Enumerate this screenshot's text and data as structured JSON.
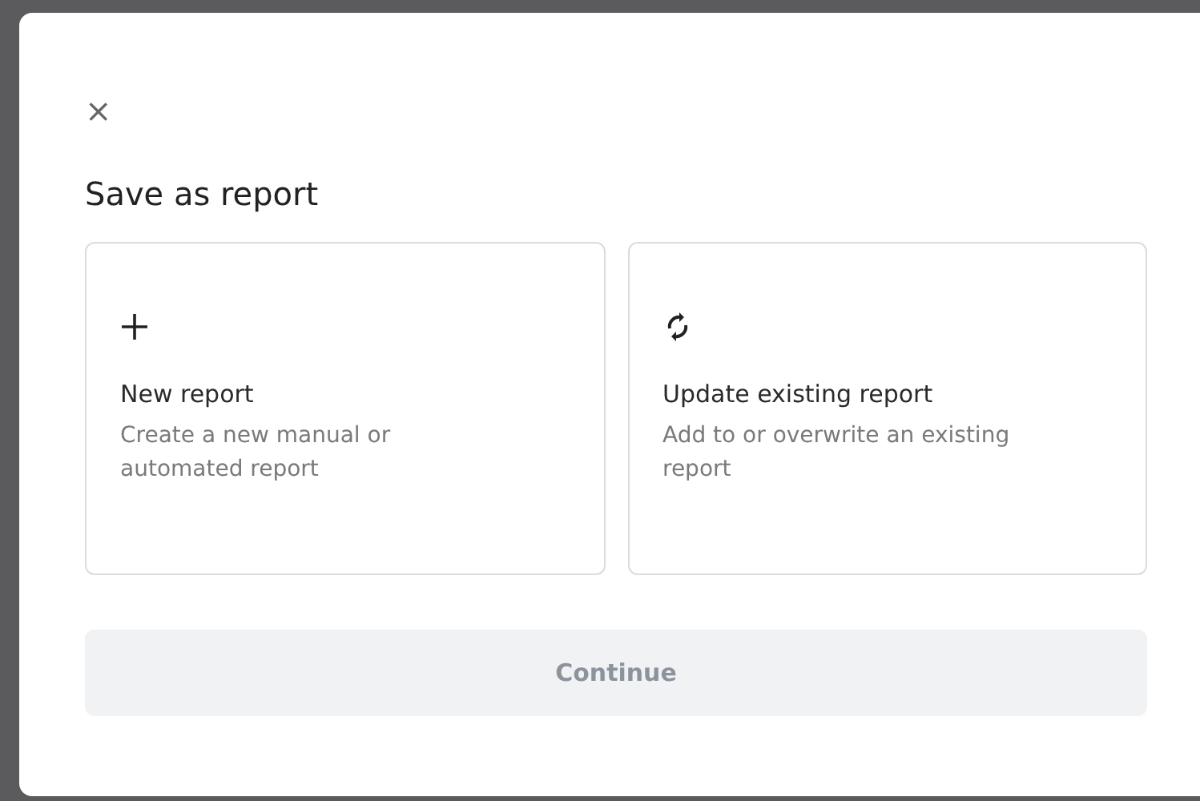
{
  "dialog": {
    "close_label": "×",
    "title": "Save as report",
    "options": [
      {
        "kind": "new",
        "title": "New report",
        "description": "Create a new manual or automated report",
        "selected": false
      },
      {
        "kind": "update",
        "title": "Update existing report",
        "description": "Add to or overwrite an existing report",
        "selected": false
      }
    ],
    "continue_button": {
      "label": "Continue",
      "disabled": true
    }
  }
}
